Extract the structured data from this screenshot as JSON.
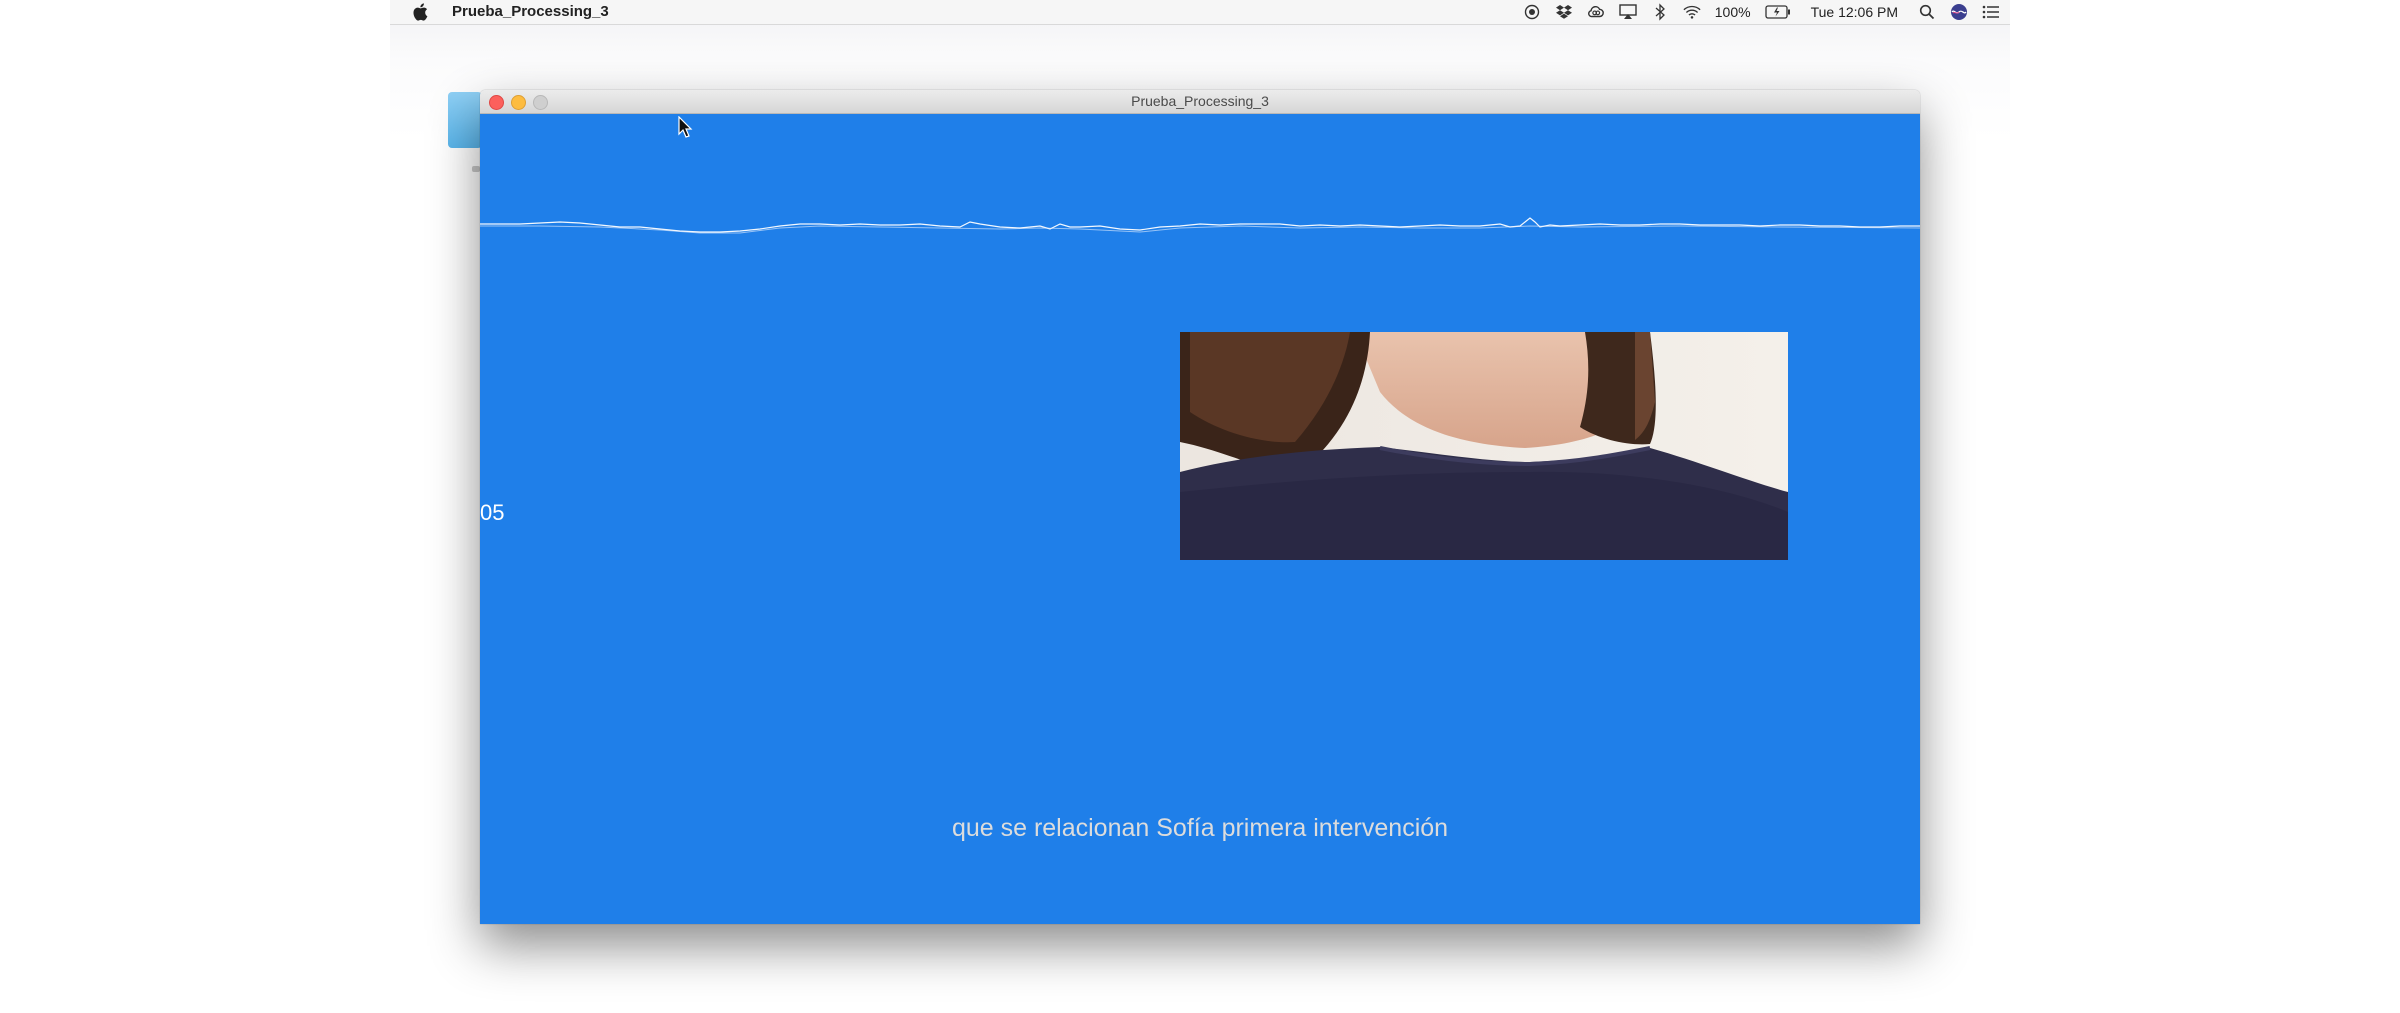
{
  "menubar": {
    "app_name": "Prueba_Processing_3",
    "battery_percent": "100%",
    "clock": "Tue 12:06 PM",
    "icons": [
      "apple-icon",
      "record-icon",
      "dropbox-icon",
      "creative-cloud-icon",
      "airplay-icon",
      "bluetooth-icon",
      "wifi-icon",
      "battery-icon",
      "spotlight-icon",
      "siri-icon",
      "notification-center-icon"
    ]
  },
  "window": {
    "title": "Prueba_Processing_3",
    "background_color": "#1f7fe9",
    "counter": "05",
    "caption": "que se relacionan Sofía primera intervención"
  }
}
